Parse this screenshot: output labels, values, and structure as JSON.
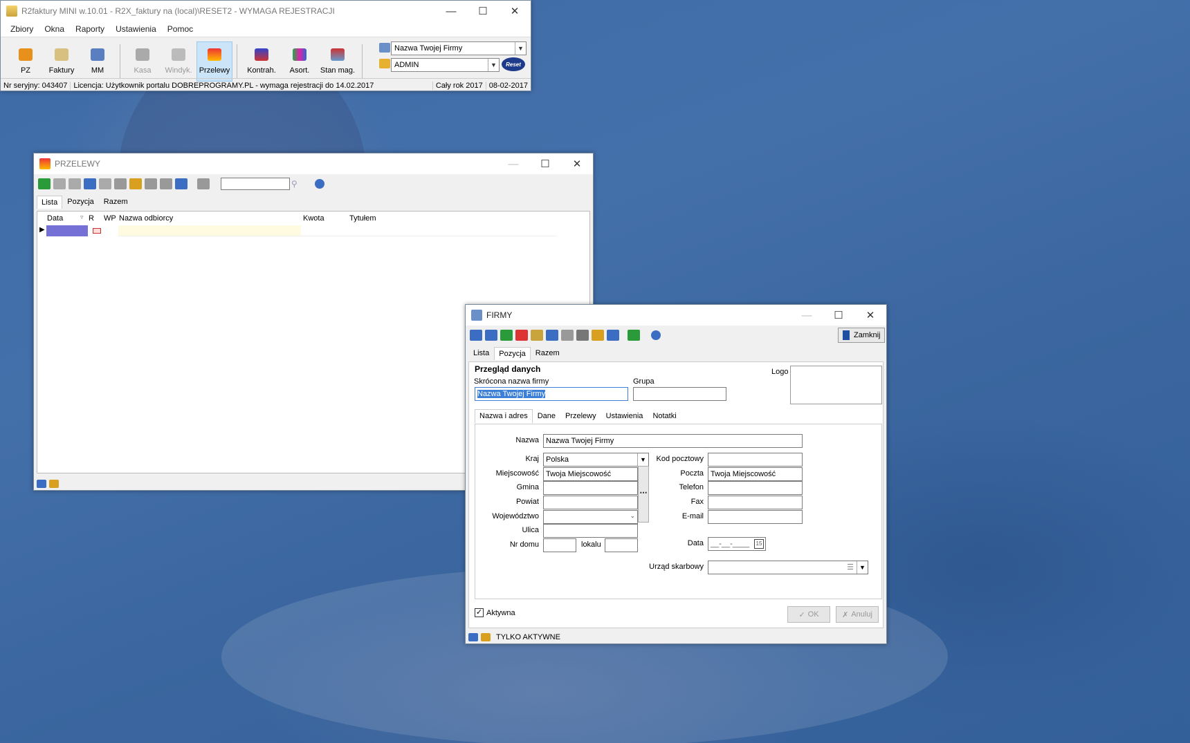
{
  "main_window": {
    "title": "R2faktury MINI w.10.01 - R2X_faktury na (local)\\RESET2 - WYMAGA REJESTRACJI",
    "menu": [
      "Zbiory",
      "Okna",
      "Raporty",
      "Ustawienia",
      "Pomoc"
    ],
    "toolbar": [
      {
        "label": "PZ",
        "icon": "truck-orange-icon",
        "disabled": false
      },
      {
        "label": "Faktury",
        "icon": "invoice-icon",
        "disabled": false
      },
      {
        "label": "MM",
        "icon": "truck-blue-icon",
        "disabled": false
      },
      {
        "label": "Kasa",
        "icon": "cash-register-icon",
        "disabled": true
      },
      {
        "label": "Windyk.",
        "icon": "debt-collection-icon",
        "disabled": true
      },
      {
        "label": "Przelewy",
        "icon": "transfer-icon",
        "disabled": false,
        "active": true
      },
      {
        "label": "Kontrah.",
        "icon": "contractors-icon",
        "disabled": false
      },
      {
        "label": "Asort.",
        "icon": "assortment-icon",
        "disabled": false
      },
      {
        "label": "Stan mag.",
        "icon": "stock-icon",
        "disabled": false
      }
    ],
    "company_select": "Nazwa Twojej Firmy",
    "user_select": "ADMIN",
    "logo_text": "Reset",
    "status": {
      "serial": "Nr seryjny: 043407",
      "license": "Licencja: Użytkownik portalu DOBREPROGRAMY.PL - wymaga rejestracji do 14.02.2017",
      "period": "Cały rok 2017",
      "date": "08-02-2017"
    }
  },
  "przelewy": {
    "title": "PRZELEWY",
    "search_value": "",
    "tabs": [
      "Lista",
      "Pozycja",
      "Razem"
    ],
    "columns": [
      "Data",
      "R",
      "WP",
      "Nazwa odbiorcy",
      "Kwota",
      "Tytułem"
    ]
  },
  "firmy": {
    "title": "FIRMY",
    "close_label": "Zamknij",
    "tabs": [
      "Lista",
      "Pozycja",
      "Razem"
    ],
    "section": "Przegląd danych",
    "short_name_label": "Skrócona nazwa firmy",
    "short_name": "Nazwa Twojej Firmy",
    "group_label": "Grupa",
    "group": "",
    "logo_label": "Logo",
    "subtabs": [
      "Nazwa i adres",
      "Dane",
      "Przelewy",
      "Ustawienia",
      "Notatki"
    ],
    "fields": {
      "nazwa_label": "Nazwa",
      "nazwa": "Nazwa Twojej Firmy",
      "kraj_label": "Kraj",
      "kraj": "Polska",
      "miejscowosc_label": "Miejscowość",
      "miejscowosc": "Twoja Miejscowość",
      "gmina_label": "Gmina",
      "gmina": "",
      "powiat_label": "Powiat",
      "powiat": "",
      "wojewodztwo_label": "Województwo",
      "wojewodztwo": "",
      "ulica_label": "Ulica",
      "ulica": "",
      "nr_domu_label": "Nr domu",
      "nr_domu": "",
      "lokalu_label": "lokalu",
      "lokalu": "",
      "kod_label": "Kod pocztowy",
      "kod": "",
      "poczta_label": "Poczta",
      "poczta": "Twoja Miejscowość",
      "telefon_label": "Telefon",
      "telefon": "",
      "fax_label": "Fax",
      "fax": "",
      "email_label": "E-mail",
      "email": "",
      "data_label": "Data",
      "data": "__-__-____",
      "urzad_label": "Urząd skarbowy",
      "urzad": ""
    },
    "aktywna_label": "Aktywna",
    "aktywna": true,
    "ok_label": "OK",
    "anuluj_label": "Anuluj",
    "status": "TYLKO AKTYWNE"
  }
}
